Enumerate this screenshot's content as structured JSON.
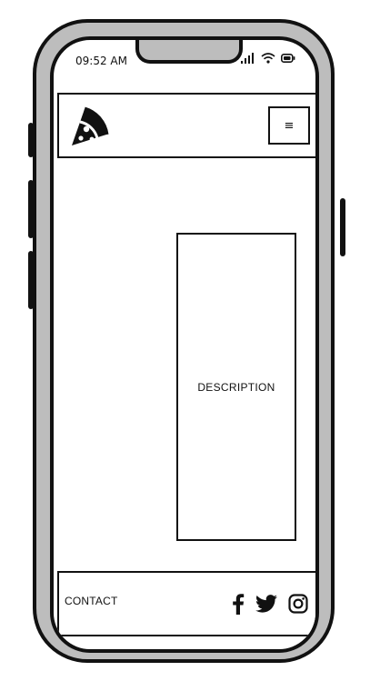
{
  "status_bar": {
    "time": "09:52 AM",
    "icons": [
      "signal-icon",
      "wifi-icon",
      "battery-icon"
    ]
  },
  "header": {
    "logo_icon": "pizza-slice-icon",
    "menu_label": "≡"
  },
  "main": {
    "description_label": "DESCRIPTION"
  },
  "footer": {
    "contact_label": "CONTACT",
    "social_icons": [
      "facebook-icon",
      "twitter-icon",
      "instagram-icon"
    ]
  },
  "colors": {
    "frame": "#bdbdbd",
    "ink": "#111111",
    "screen": "#ffffff"
  }
}
